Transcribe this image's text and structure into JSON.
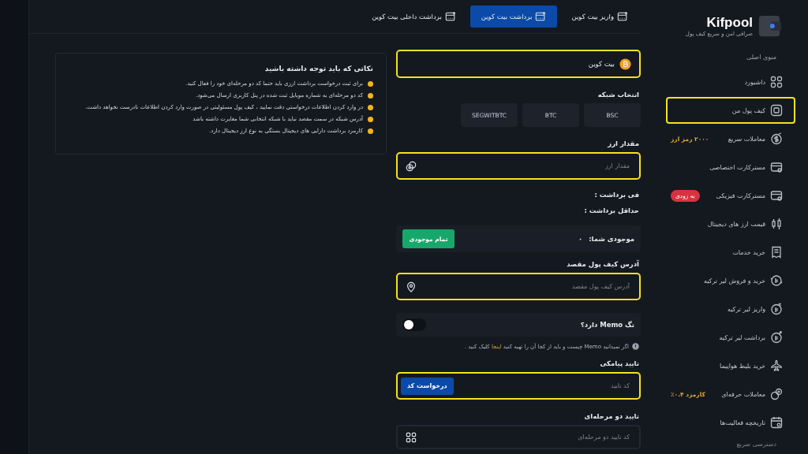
{
  "sidebar": {
    "logo": {
      "name": "Kifpool",
      "tagline": "صرافی امن و سریع کیف پول"
    },
    "section_title": "منوی اصلی",
    "items": [
      {
        "label": "داشبورد",
        "highlighted": false
      },
      {
        "label": "کیف پول من",
        "highlighted": true
      },
      {
        "label": "معاملات سریع",
        "highlighted": false,
        "badge": {
          "kind": "text",
          "text": "۲۰۰۰ رمز ارز"
        }
      },
      {
        "label": "مسترکارت اختصاصی",
        "highlighted": false
      },
      {
        "label": "مسترکارت فیزیکی",
        "highlighted": false,
        "badge": {
          "kind": "pill",
          "text": "به زودی"
        }
      },
      {
        "label": "قیمت ارز های دیجیتال",
        "highlighted": false
      },
      {
        "label": "خرید خدمات",
        "highlighted": false
      },
      {
        "label": "خرید و فروش لیر ترکیه",
        "highlighted": false
      },
      {
        "label": "واریز لیر ترکیه",
        "highlighted": false
      },
      {
        "label": "برداشت لیر ترکیه",
        "highlighted": false
      },
      {
        "label": "خرید بلیط هواپیما",
        "highlighted": false
      },
      {
        "label": "معاملات حرفه‌ای",
        "highlighted": false,
        "badge": {
          "kind": "text",
          "text": "کارمزد ۰.۴٪"
        }
      },
      {
        "label": "تاریخچه فعالیت‌ها",
        "highlighted": false
      }
    ],
    "footer_title": "دسترسی سریع"
  },
  "tabs": [
    {
      "label": "واریز بیت کوین",
      "selected": false
    },
    {
      "label": "برداشت بیت کوین",
      "selected": true
    },
    {
      "label": "برداشت داخلی بیت کوین",
      "selected": false
    }
  ],
  "form": {
    "coin": {
      "value": "بیت کوین",
      "highlighted": true
    },
    "network_label": "انتخاب شبکه",
    "networks": [
      "BSC",
      "BTC",
      "SEGWITBTC"
    ],
    "amount": {
      "label": "مقدار ارز",
      "placeholder": "مقدار ارز",
      "highlighted": true
    },
    "fee_label": "فی برداشت :",
    "min_label": "حداقل برداشت :",
    "balance": {
      "label": "موجودی شما:",
      "value": "۰",
      "button": "تمام موجودی"
    },
    "address": {
      "label": "آدرس کیف پول مقصد",
      "placeholder": "آدرس کیف پول مقصد",
      "highlighted": true
    },
    "memo": {
      "label": "تگ Memo دارد؟",
      "on": false
    },
    "memo_hint": {
      "text": "اگر نمیدانید Memo چیست و باید از کجا آن را تهیه کنید",
      "link": "اینجا",
      "after": "کلیک کنید ."
    },
    "sms": {
      "label": "تایید پیامکی",
      "placeholder": "کد تایید",
      "button": "درخواست کد",
      "highlighted": true
    },
    "twofa": {
      "label": "تایید دو مرحله‌ای",
      "placeholder": "کد تایید دو مرحله‌ای",
      "highlighted": false
    }
  },
  "notes": {
    "title": "نکاتی که باید توجه داشته باشید",
    "items": [
      "برای ثبت درخواست برداشت ارزی باید حتما کد دو مرحله‌ای خود را فعال کنید.",
      "کد دو مرحله‌ای به شماره موبایل ثبت شده در پنل کاربری ارسال می‌شود.",
      "در وارد کردن اطلاعات درخواستی دقت نمایید ، کیف پول مسئولیتی در صورت وارد کردن اطلاعات نادرست نخواهد داشت.",
      "آدرس شبکه در سمت مقصد نباید با شبکه انتخابی شما مغایرت داشته باشد",
      "کارمزد برداشت دارایی های دیجیتال بستگی به نوع ارز دیجیتال دارد."
    ]
  }
}
